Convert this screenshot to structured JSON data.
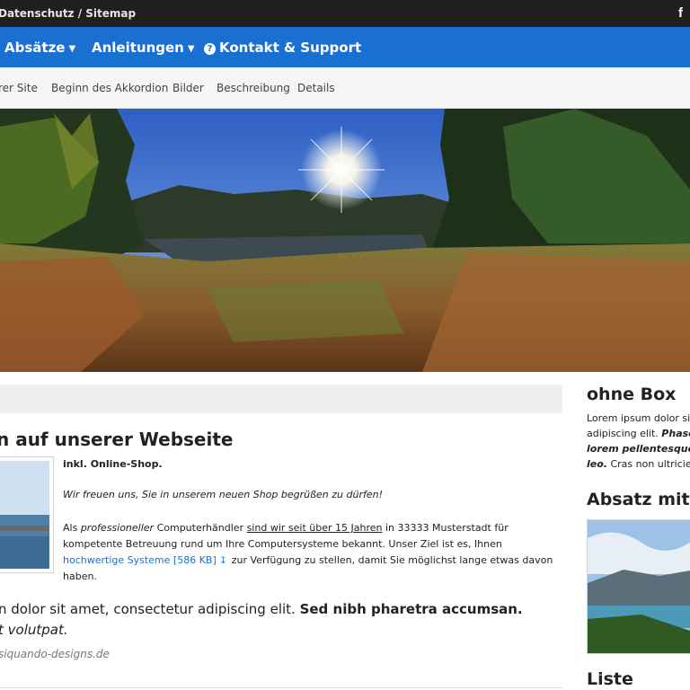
{
  "topbar": {
    "links": "Datenschutz / Sitemap",
    "facebook_icon": "f"
  },
  "mainnav": {
    "items": [
      {
        "label": "Absätze",
        "dropdown": true
      },
      {
        "label": "Anleitungen",
        "dropdown": true
      },
      {
        "label": "Kontakt & Support",
        "icon": "question-circle-icon"
      }
    ]
  },
  "subnav": {
    "items": [
      "rer Site",
      "Beginn des Akkordion",
      "Bilder",
      "Beschreibung",
      "Details"
    ]
  },
  "main": {
    "headline": "n auf unserer Webseite",
    "p1": "inkl. Online-Shop.",
    "p2": "Wir freuen uns, Sie in unserem neuen Shop begrüßen zu dürfen!",
    "p3": {
      "a": "Als ",
      "b": "professioneller",
      "c": " Computerhändler ",
      "d": "sind wir seit über 15 Jahren",
      "e": " in 33333 Musterstadt für kompetente Betreuung rund um Ihre Computersysteme bekannt. Unser Ziel ist es, Ihnen ",
      "f": "hochwertige Systeme [586 KB]",
      "g": " zur Verfügung zu stellen, damit Sie möglichst lange etwas davon haben."
    },
    "big_line1_a": "n dolor sit amet, consectetur adipiscing elit. ",
    "big_line1_b": "Sed nibh pharetra accumsan.",
    "big_line2": "t volutpat.",
    "credit": "siquando-designs.de"
  },
  "sidebar": {
    "title1": "ohne Box",
    "text_a": "Lorem ipsum dolor si adipiscing elit. ",
    "text_b": "Phase lorem pellentesque leo.",
    "text_c": " Cras non ultricie",
    "title2": "Absatz mit B",
    "title3": "Liste"
  },
  "colors": {
    "topbar": "#1f1f1f",
    "nav": "#1a6fd2",
    "link": "#1a6fd2"
  }
}
